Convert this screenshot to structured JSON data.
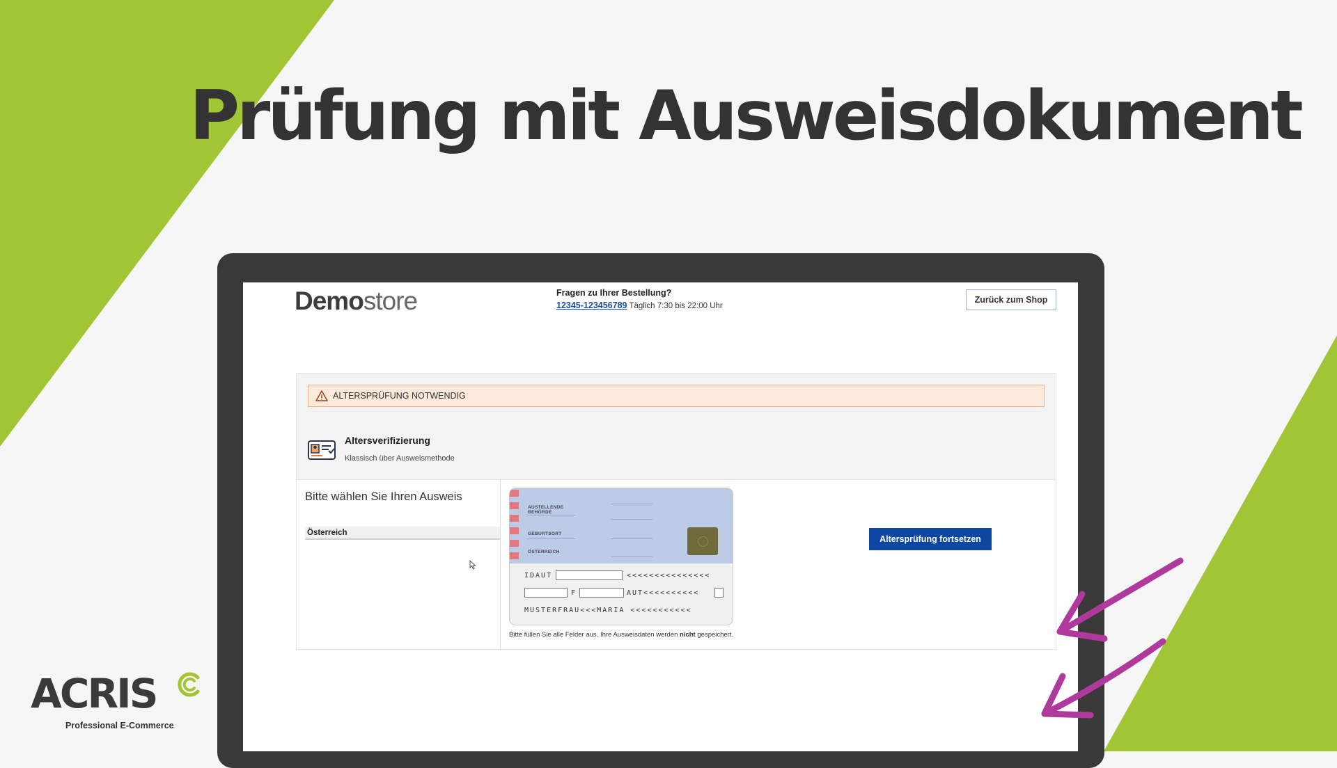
{
  "headline": "Prüfung mit Ausweisdokument",
  "colors": {
    "accent_green": "#a1c535",
    "arrow_magenta": "#b03a9b",
    "primary_button": "#0d47a1",
    "alert_bg": "#fbe9dc"
  },
  "store": {
    "logo_bold": "Demo",
    "logo_light": "store",
    "contact_question": "Fragen zu Ihrer Bestellung?",
    "contact_phone": "12345-123456789",
    "contact_hours": "Täglich 7:30 bis 22:00 Uhr",
    "back_button": "Zurück zum Shop"
  },
  "alert": {
    "text": "ALTERSPRÜFUNG NOTWENDIG",
    "icon": "warning-icon"
  },
  "verification": {
    "title": "Altersverifizierung",
    "subtitle": "Klassisch über Ausweismethode",
    "icon": "id-card-icon"
  },
  "selection": {
    "prompt": "Bitte wählen Sie Ihren Ausweis",
    "country": "Österreich"
  },
  "id_card": {
    "labels": [
      "AUSTELLENDE BEHÖRDE",
      "GEBURTSORT",
      "ÖSTERREICH"
    ],
    "mrz_line1_prefix": "IDAUT",
    "mrz_line1_suffix": "<<<<<<<<<<<<<<<",
    "mrz_line2_sex": "F",
    "mrz_line2_nation": "AUT<<<<<<<<<<",
    "mrz_line3": "MUSTERFRAU<<<MARIA <<<<<<<<<<<"
  },
  "note": {
    "before": "Bitte füllen Sie alle Felder aus. Ihre Ausweisdaten werden ",
    "bold": "nicht",
    "after": " gespeichert."
  },
  "continue_button": "Altersprüfung fortsetzen",
  "brand": {
    "name": "ACRIS",
    "tagline": "Professional E-Commerce"
  }
}
